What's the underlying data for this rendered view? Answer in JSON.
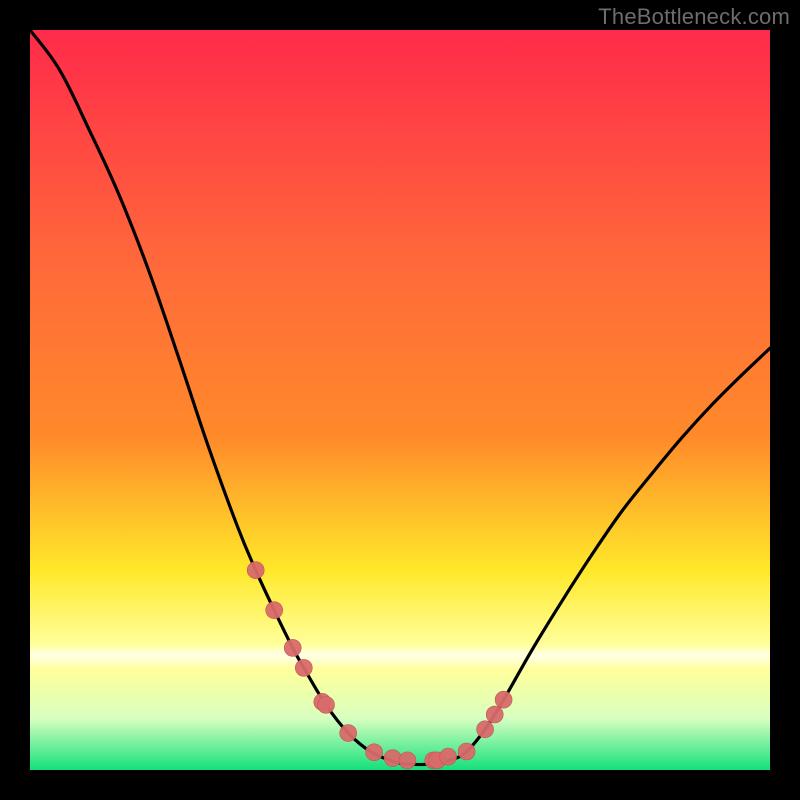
{
  "watermark": "TheBottleneck.com",
  "colors": {
    "frame": "#000000",
    "gradient_top": "#ff2a4a",
    "gradient_mid1": "#ff8a2a",
    "gradient_mid2": "#ffe82a",
    "gradient_band": "#ffff9a",
    "gradient_pale": "#d8ffc0",
    "gradient_bottom": "#14e07c",
    "curve": "#000000",
    "marker_fill": "#d86a6a",
    "marker_stroke": "#c45454"
  },
  "chart_data": {
    "type": "line",
    "title": "",
    "xlabel": "",
    "ylabel": "",
    "xlim": [
      0,
      1
    ],
    "ylim": [
      0,
      1
    ],
    "series": [
      {
        "name": "bottleneck-curve",
        "x": [
          0.0,
          0.04,
          0.08,
          0.12,
          0.16,
          0.2,
          0.24,
          0.28,
          0.305,
          0.33,
          0.355,
          0.37,
          0.4,
          0.43,
          0.46,
          0.49,
          0.51,
          0.54,
          0.57,
          0.59,
          0.615,
          0.64,
          0.68,
          0.72,
          0.76,
          0.8,
          0.84,
          0.88,
          0.92,
          0.96,
          1.0
        ],
        "y": [
          1.0,
          0.946,
          0.865,
          0.778,
          0.676,
          0.56,
          0.44,
          0.33,
          0.27,
          0.216,
          0.165,
          0.138,
          0.088,
          0.05,
          0.025,
          0.012,
          0.008,
          0.008,
          0.014,
          0.025,
          0.055,
          0.095,
          0.165,
          0.23,
          0.292,
          0.35,
          0.4,
          0.448,
          0.492,
          0.532,
          0.57
        ]
      }
    ],
    "markers": {
      "name": "highlighted-points",
      "x": [
        0.305,
        0.33,
        0.355,
        0.37,
        0.395,
        0.4,
        0.43,
        0.465,
        0.49,
        0.51,
        0.545,
        0.55,
        0.565,
        0.59,
        0.615,
        0.628,
        0.64
      ],
      "y": [
        0.27,
        0.216,
        0.165,
        0.138,
        0.092,
        0.088,
        0.05,
        0.024,
        0.016,
        0.013,
        0.013,
        0.013,
        0.018,
        0.025,
        0.055,
        0.075,
        0.095
      ]
    }
  }
}
